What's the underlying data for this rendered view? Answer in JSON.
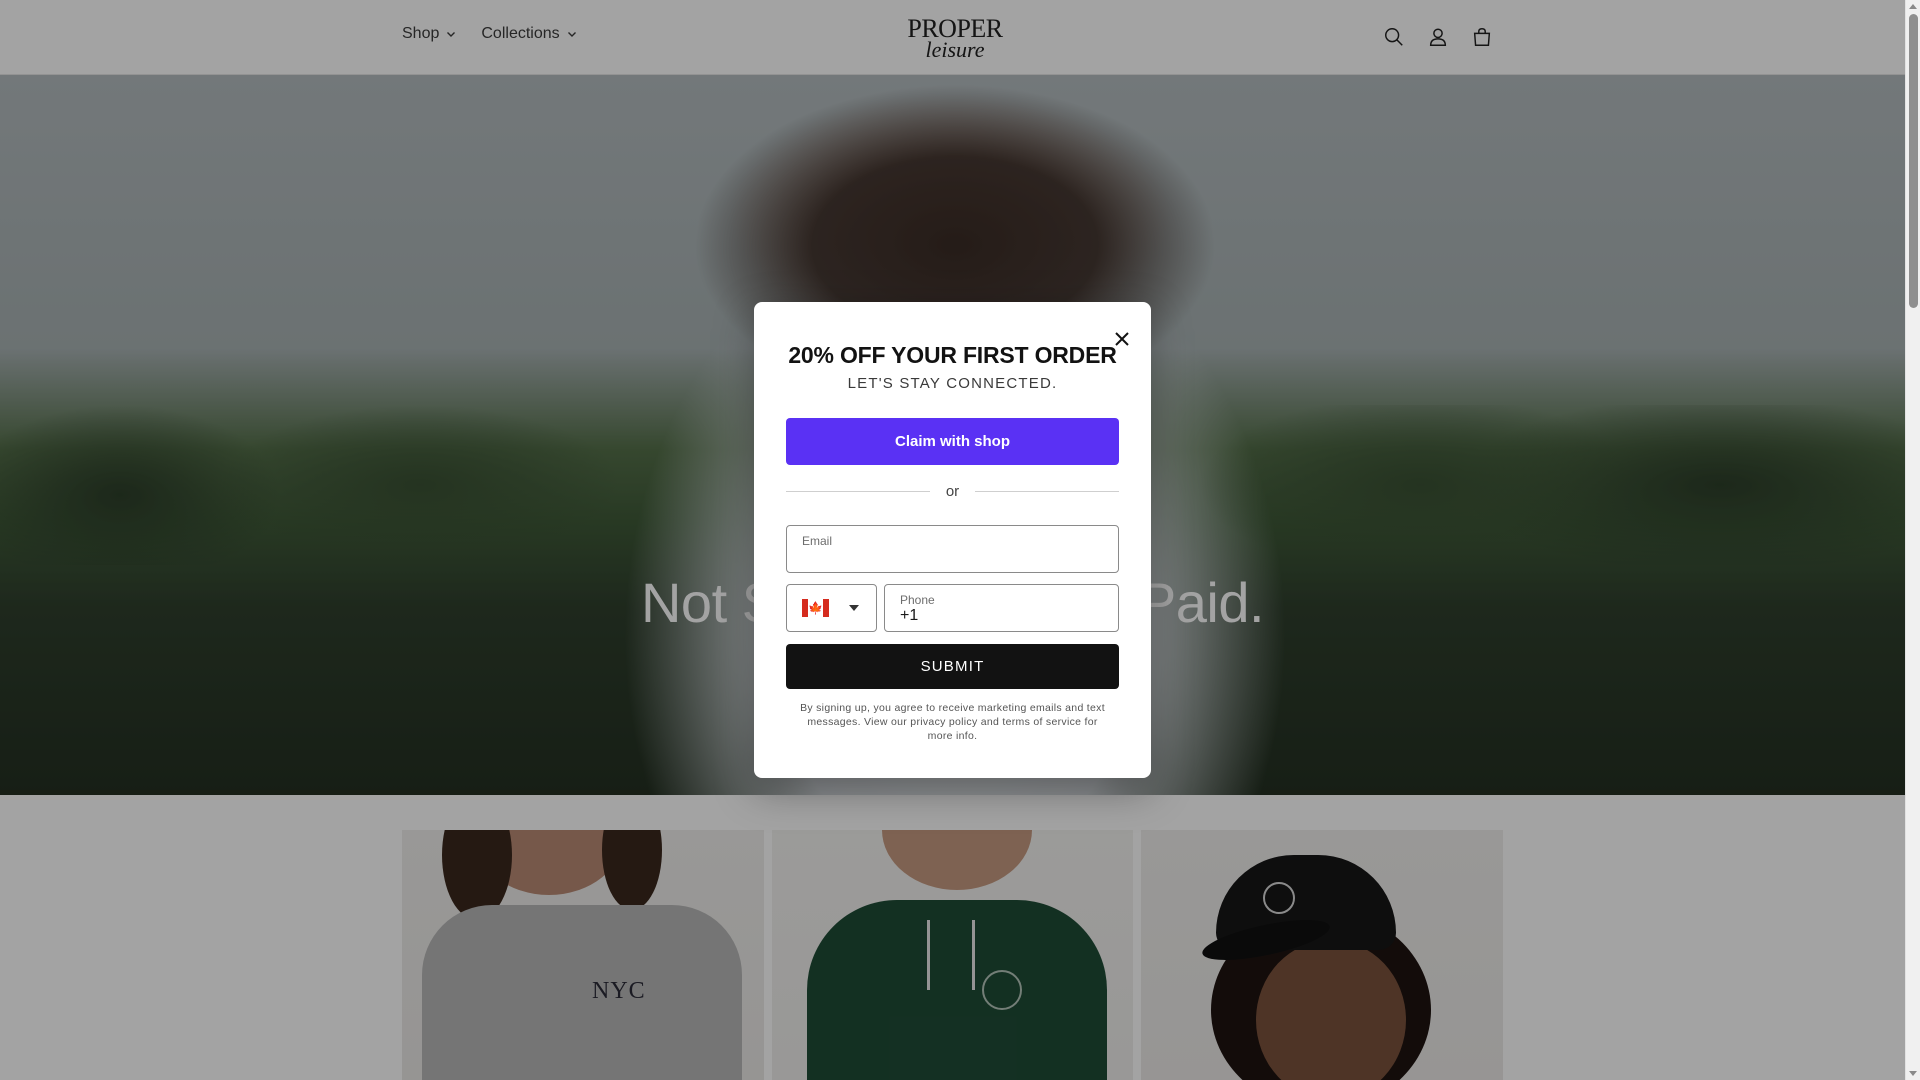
{
  "header": {
    "nav": [
      {
        "label": "Shop"
      },
      {
        "label": "Collections"
      }
    ],
    "logo": {
      "line1": "PROPER",
      "line2": "leisure"
    },
    "icons": [
      "search-icon",
      "account-icon",
      "cart-icon"
    ]
  },
  "hero": {
    "heading": "Not Sponsored. Not Paid.",
    "subtext": ""
  },
  "products": {
    "cards": [
      {
        "print": "NYC"
      },
      {
        "print": ""
      },
      {
        "print": ""
      }
    ]
  },
  "modal": {
    "title": "20% OFF YOUR FIRST ORDER",
    "subtitle": "LET'S STAY CONNECTED.",
    "shop_button": "Claim with shop",
    "divider_text": "or",
    "email": {
      "label": "Email",
      "value": ""
    },
    "country": {
      "code": "CA",
      "name": "Canada"
    },
    "phone": {
      "label": "Phone",
      "value": "+1"
    },
    "submit": "SUBMIT",
    "legal": "By signing up, you agree to receive marketing emails and text messages. View our privacy policy and terms of service for more info."
  },
  "colors": {
    "shop_purple": "#5a31f4",
    "submit_black": "#121212",
    "overlay": "rgba(0,0,0,0.36)"
  }
}
